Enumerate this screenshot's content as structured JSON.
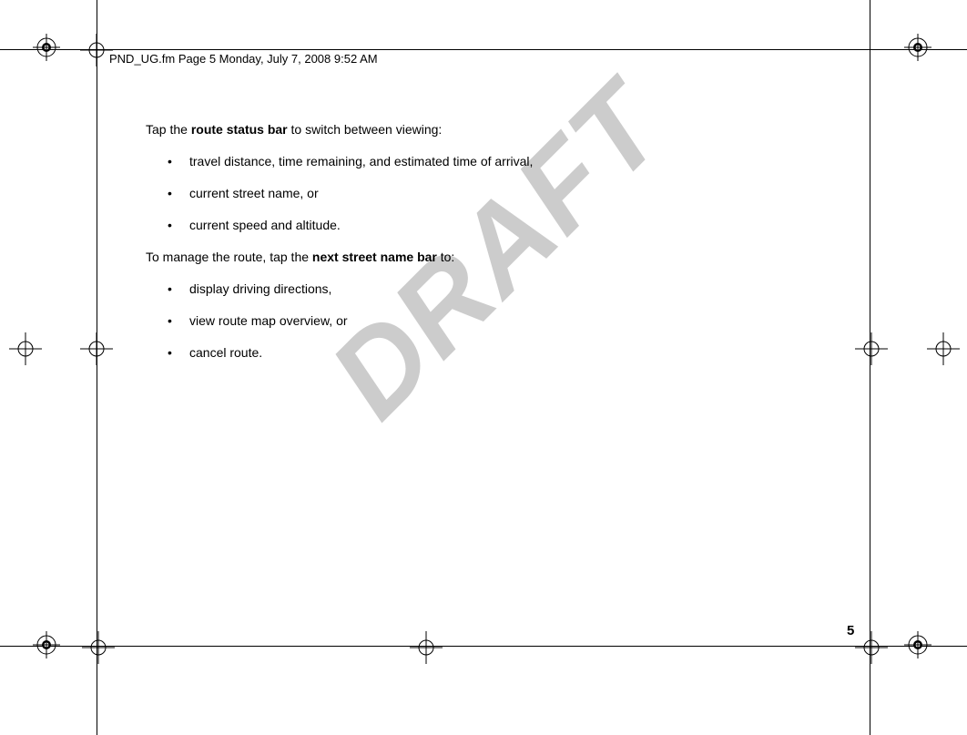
{
  "header": {
    "text": "PND_UG.fm  Page 5  Monday, July 7, 2008  9:52 AM"
  },
  "content": {
    "para1_part1": "Tap the ",
    "para1_bold": "route status bar",
    "para1_part2": " to switch between viewing:",
    "list1": {
      "item1": "travel distance, time remaining, and estimated time of arrival,",
      "item2": "current street name, or",
      "item3": "current speed and altitude."
    },
    "para2_part1": "To manage the route, tap the ",
    "para2_bold": "next street name bar",
    "para2_part2": " to:",
    "list2": {
      "item1": "display driving directions,",
      "item2": "view route map overview, or",
      "item3": "cancel route."
    }
  },
  "watermark": "DRAFT",
  "page_number": "5"
}
